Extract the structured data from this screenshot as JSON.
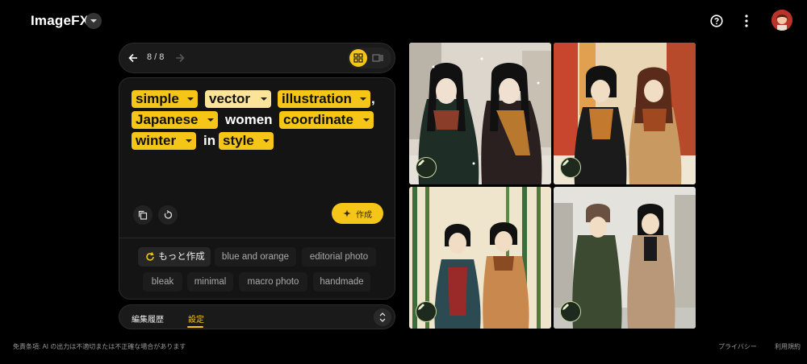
{
  "app": {
    "title": "ImageFX",
    "title_caret_icon": "chevron-down-icon",
    "help_icon": "help-circle-icon",
    "menu_icon": "more-vert-icon",
    "avatar_icon": "user-avatar"
  },
  "history_nav": {
    "back_icon": "arrow-back-icon",
    "counter": "8 / 8",
    "forward_icon": "arrow-forward-icon",
    "grid_view_icon": "grid-view-icon",
    "single_view_icon": "single-view-icon"
  },
  "prompt": {
    "chips": [
      {
        "text": "simple"
      },
      {
        "text": "vector"
      },
      {
        "text": "illustration"
      },
      {
        "text": "Japanese"
      },
      {
        "text": "coordinate"
      },
      {
        "text": "winter"
      },
      {
        "text": "style"
      }
    ],
    "plain_words": [
      ",",
      "women",
      "in"
    ]
  },
  "actions": {
    "copy_icon": "copy-icon",
    "reset_icon": "reset-icon",
    "create_label": "作成",
    "create_icon": "sparkle-icon"
  },
  "suggestions": {
    "primary_label": "もっと作成",
    "primary_icon": "refresh-icon",
    "items": [
      "blue and orange",
      "editorial photo",
      "bleak",
      "minimal",
      "macro photo",
      "handmade"
    ]
  },
  "tabs": {
    "history_label": "編集履歴",
    "settings_label": "設定",
    "expand_icon": "unfold-icon"
  },
  "images": [
    {
      "name": "generated-image-1",
      "edit_icon": "edit-icon"
    },
    {
      "name": "generated-image-2",
      "edit_icon": "edit-icon"
    },
    {
      "name": "generated-image-3",
      "edit_icon": "edit-icon"
    },
    {
      "name": "generated-image-4",
      "edit_icon": "edit-icon"
    }
  ],
  "footer": {
    "disclaimer": "免責条項: AI の出力は不適切または不正確な場合があります",
    "privacy": "プライバシー",
    "terms": "利用規約"
  },
  "colors": {
    "accent": "#f5c518",
    "background": "#000000",
    "panel": "#141414"
  }
}
